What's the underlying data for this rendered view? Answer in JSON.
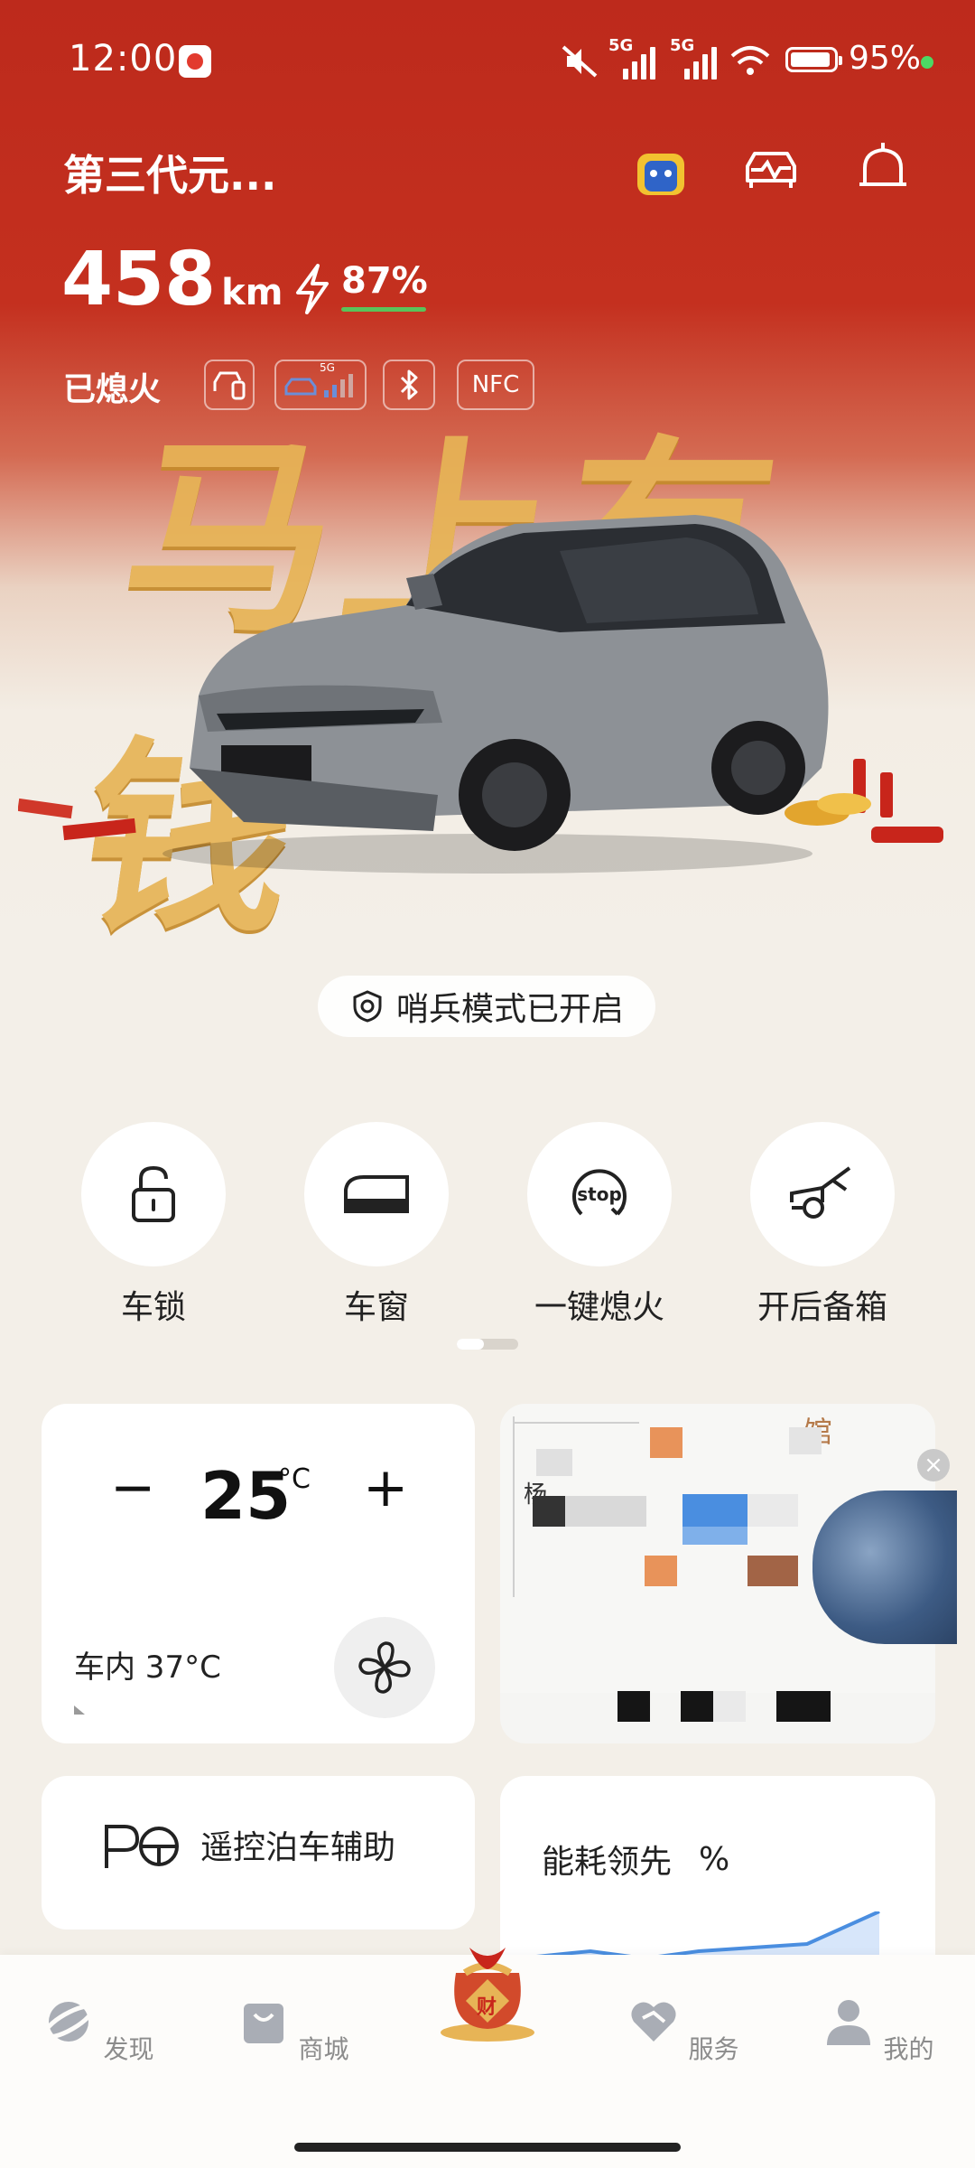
{
  "status_bar": {
    "time": "12:00",
    "network_1": "5G",
    "network_2": "5G",
    "battery_pct": "95%"
  },
  "header": {
    "car_name": "第三代元...",
    "range_value": "458",
    "range_unit": "km",
    "charge_pct": "87%",
    "state": "已熄火"
  },
  "status_chips": [
    {
      "icon": "car-connect-icon",
      "label": ""
    },
    {
      "icon": "car-5g-signal-icon",
      "label": "5G"
    },
    {
      "icon": "bluetooth-icon",
      "label": ""
    },
    {
      "icon": "nfc-icon",
      "label": "NFC"
    }
  ],
  "banner": {
    "text": "马上有钱"
  },
  "sentry": {
    "label": "哨兵模式已开启"
  },
  "quick_actions": [
    {
      "label": "车锁",
      "icon": "lock-icon"
    },
    {
      "label": "车窗",
      "icon": "window-icon"
    },
    {
      "label": "一键熄火",
      "icon": "stop-icon",
      "icon_text": "stop"
    },
    {
      "label": "开后备箱",
      "icon": "trunk-icon"
    }
  ],
  "climate": {
    "minus": "−",
    "temperature": "25",
    "unit": "°C",
    "plus": "+",
    "inside": "车内 37°C"
  },
  "map_card": {
    "text_1": "馆",
    "text_2": "杨"
  },
  "parking": {
    "label": "遥控泊车辅助"
  },
  "energy": {
    "label": "能耗领先",
    "pct": "%"
  },
  "bottom_nav": [
    {
      "label": "发现",
      "icon": "planet-icon"
    },
    {
      "label": "商城",
      "icon": "shopping-bag-icon"
    },
    {
      "label": "",
      "icon": "lucky-bag-icon",
      "badge_text": "财"
    },
    {
      "label": "服务",
      "icon": "handshake-icon"
    },
    {
      "label": "我的",
      "icon": "person-icon"
    }
  ],
  "colors": {
    "hero_red": "#bd2a1c",
    "gold": "#e7b456",
    "accent_green": "#5ac35a",
    "nav_gray": "#8c8c8c"
  }
}
